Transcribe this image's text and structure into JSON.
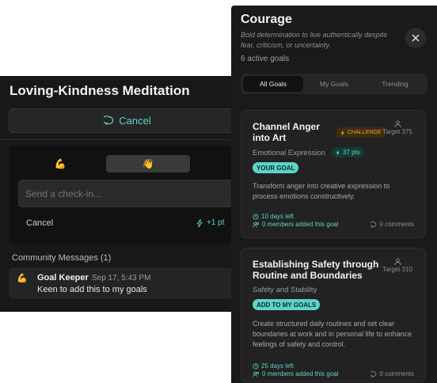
{
  "left_panel": {
    "title": "Loving-Kindness Meditation",
    "cancel_button_label": "Cancel",
    "emoji_options": [
      "💪",
      "👋"
    ],
    "checkin_placeholder": "Send a check-in...",
    "checkin_cancel_label": "Cancel",
    "checkin_points": "+1 pt",
    "community_heading": "Community Messages (1)",
    "messages": [
      {
        "avatar": "💪",
        "author": "Goal Keeper",
        "time": "Sep 17, 5:43 PM",
        "text": "Keen to add this to my goals"
      }
    ]
  },
  "right_panel": {
    "title": "Courage",
    "subtitle": "Bold determination to live authentically despite fear, criticism, or uncertainty.",
    "active_count": "6 active goals",
    "tabs": [
      "All Goals",
      "My Goals",
      "Trending"
    ],
    "active_tab": "All Goals",
    "cards": [
      {
        "title": "Channel Anger into Art",
        "badge": "CHALLENGE",
        "target": "Target 375",
        "category": "Emotional Expression",
        "points": "37 pts",
        "action_label": "YOUR GOAL",
        "description": "Transform anger into creative expression to process emotions constructively.",
        "days_left": "10 days left",
        "members": "0 members added this goal",
        "comments": "0 comments"
      },
      {
        "title": "Establishing Safety through Routine and Boundaries",
        "target": "Target 310",
        "category": "Safety and Stability",
        "action_label": "ADD TO MY GOALS",
        "description": "Create structured daily routines and set clear boundaries at work and in personal life to enhance feelings of safety and control.",
        "days_left": "25 days left",
        "members": "0 members added this goal",
        "comments": "0 comments"
      }
    ]
  },
  "colors": {
    "accent": "#5ed3c8",
    "challenge": "#e8a23a",
    "panel_bg": "#1a1a1a"
  }
}
